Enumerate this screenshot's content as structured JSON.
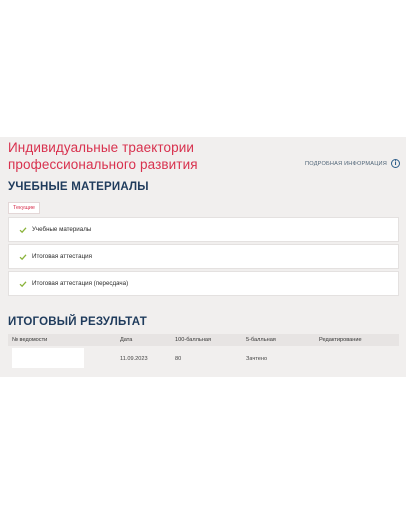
{
  "page": {
    "title": "Индивидуальные траектории профессионального развития",
    "more_info_label": "ПОДРОБНАЯ ИНФОРМАЦИЯ",
    "info_icon_glyph": "i"
  },
  "materials": {
    "heading": "УЧЕБНЫЕ МАТЕРИАЛЫ",
    "tab_label": "Текущие",
    "check_color": "#8ab33a",
    "items": [
      {
        "label": "Учебные материалы",
        "icon": "check-icon"
      },
      {
        "label": "Итоговая аттестация",
        "icon": "check-icon"
      },
      {
        "label": "Итоговая аттестация (пересдача)",
        "icon": "check-icon"
      }
    ]
  },
  "result": {
    "heading": "ИТОГОВЫЙ РЕЗУЛЬТАТ",
    "columns": [
      "№ ведомости",
      "Дата",
      "100-балльная",
      "5-балльная",
      "Редактирование"
    ],
    "rows": [
      {
        "record_no": "",
        "date": "11.09.2023",
        "score_100": "80",
        "score_5": "Зачтено",
        "edit": ""
      }
    ]
  },
  "colors": {
    "title": "#d8314e",
    "heading": "#1f3b5c",
    "panel_bg": "#f1efee"
  }
}
